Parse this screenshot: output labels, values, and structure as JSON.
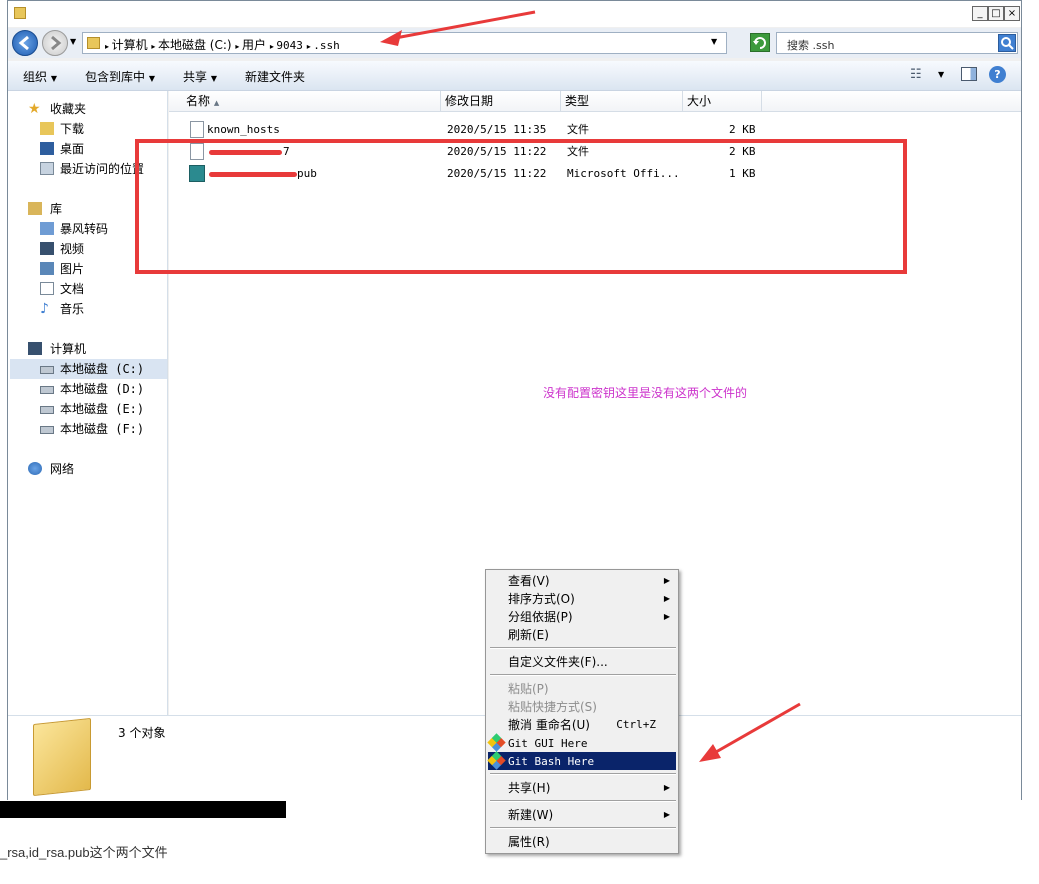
{
  "window": {
    "title_buttons": [
      "_",
      "□",
      "×"
    ]
  },
  "address": {
    "crumbs": [
      "计算机",
      "本地磁盘 (C:)",
      "用户",
      "9043",
      ".ssh"
    ],
    "search_placeholder": "搜索 .ssh"
  },
  "toolbar": {
    "organize": "组织",
    "include_library": "包含到库中",
    "share": "共享",
    "new_folder": "新建文件夹"
  },
  "nav": {
    "favorites": "收藏夹",
    "downloads": "下载",
    "desktop": "桌面",
    "recent": "最近访问的位置",
    "libraries": "库",
    "storm": "暴风转码",
    "videos": "视频",
    "pictures": "图片",
    "documents": "文档",
    "music": "音乐",
    "computer": "计算机",
    "drives": [
      "本地磁盘 (C:)",
      "本地磁盘 (D:)",
      "本地磁盘 (E:)",
      "本地磁盘 (F:)"
    ],
    "network": "网络"
  },
  "columns": {
    "name": "名称",
    "date": "修改日期",
    "type": "类型",
    "size": "大小"
  },
  "files": [
    {
      "name": "known_hosts",
      "date": "2020/5/15 11:35",
      "type": "文件",
      "size": "2 KB"
    },
    {
      "name": "7",
      "date": "2020/5/15 11:22",
      "type": "文件",
      "size": "2 KB"
    },
    {
      "name": "pub",
      "date": "2020/5/15 11:22",
      "type": "Microsoft Offi...",
      "size": "1 KB"
    }
  ],
  "annotation": "没有配置密钥这里是没有这两个文件的",
  "details": {
    "count": "3 个对象"
  },
  "context_menu": {
    "view": "查看(V)",
    "sort": "排序方式(O)",
    "group": "分组依据(P)",
    "refresh": "刷新(E)",
    "customize": "自定义文件夹(F)...",
    "paste": "粘贴(P)",
    "paste_shortcut": "粘贴快捷方式(S)",
    "undo_rename": "撤消 重命名(U)",
    "undo_shortcut": "Ctrl+Z",
    "git_gui": "Git GUI Here",
    "git_bash": "Git Bash Here",
    "share": "共享(H)",
    "new": "新建(W)",
    "properties": "属性(R)"
  },
  "page_caption": "_rsa,id_rsa.pub这个两个文件",
  "colors": {
    "annotation": "#cc33cc",
    "red_markup": "#e83a3a",
    "menu_highlight": "#0a246a"
  }
}
